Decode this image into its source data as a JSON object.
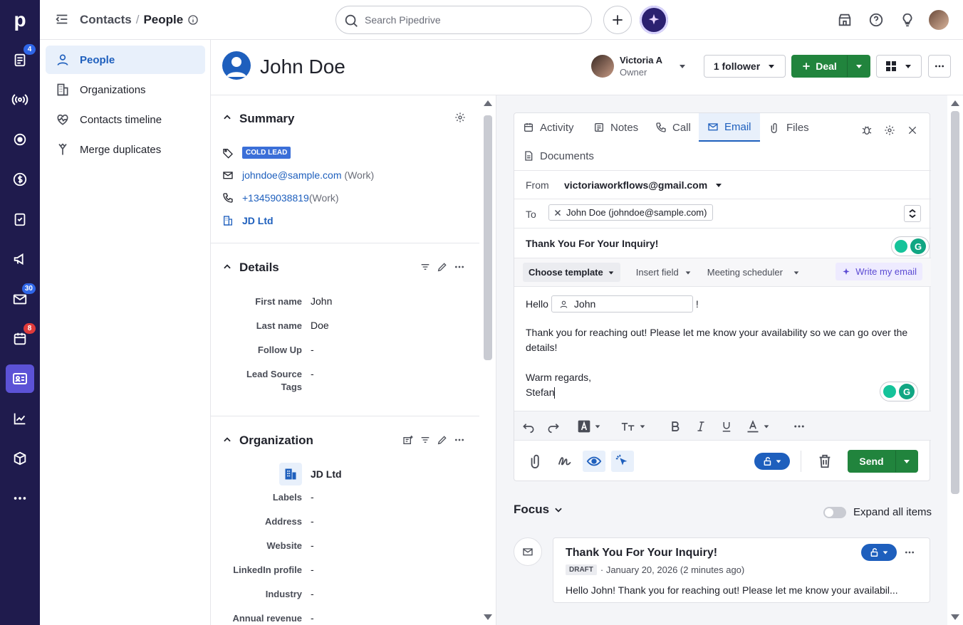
{
  "app": {
    "logo": "p",
    "brand_color": "#1f1b4d",
    "accent": "#1e5fbd"
  },
  "rail": {
    "items": [
      {
        "icon": "leads-icon",
        "badge": "4",
        "badge_color": "#2f66e8"
      },
      {
        "icon": "broadcast-icon"
      },
      {
        "icon": "target-icon"
      },
      {
        "icon": "dollar-icon"
      },
      {
        "icon": "clipboard-icon"
      },
      {
        "icon": "megaphone-icon"
      },
      {
        "icon": "mail-icon",
        "badge": "30",
        "badge_color": "#2f66e8"
      },
      {
        "icon": "calendar-icon",
        "badge": "8",
        "badge_color": "#e03a3a"
      },
      {
        "icon": "contacts-icon",
        "active": true
      },
      {
        "icon": "chart-icon"
      },
      {
        "icon": "box-icon"
      },
      {
        "icon": "more-icon"
      }
    ]
  },
  "topbar": {
    "breadcrumb_parent": "Contacts",
    "breadcrumb_sep": "/",
    "breadcrumb_current": "People",
    "search_placeholder": "Search Pipedrive"
  },
  "sidenav": {
    "items": [
      {
        "label": "People",
        "icon": "person-icon",
        "active": true
      },
      {
        "label": "Organizations",
        "icon": "building-icon"
      },
      {
        "label": "Contacts timeline",
        "icon": "heart-pulse-icon"
      },
      {
        "label": "Merge duplicates",
        "icon": "merge-icon"
      }
    ]
  },
  "header": {
    "person_name": "John Doe",
    "owner_name": "Victoria A",
    "owner_role": "Owner",
    "follower_label": "1 follower",
    "deal_label": "Deal"
  },
  "summary": {
    "title": "Summary",
    "label_tag": "COLD LEAD",
    "email": "johndoe@sample.com",
    "email_type": "(Work)",
    "phone": "+13459038819",
    "phone_type": "(Work)",
    "org": "JD Ltd"
  },
  "details": {
    "title": "Details",
    "fields": [
      {
        "label": "First name",
        "value": "John"
      },
      {
        "label": "Last name",
        "value": "Doe"
      },
      {
        "label": "Follow Up",
        "value": "-"
      },
      {
        "label": "Lead Source Tags",
        "value": "-"
      }
    ]
  },
  "organization": {
    "title": "Organization",
    "name": "JD Ltd",
    "fields": [
      {
        "label": "Labels",
        "value": "-"
      },
      {
        "label": "Address",
        "value": "-"
      },
      {
        "label": "Website",
        "value": "-"
      },
      {
        "label": "LinkedIn profile",
        "value": "-"
      },
      {
        "label": "Industry",
        "value": "-"
      },
      {
        "label": "Annual revenue",
        "value": "-"
      }
    ]
  },
  "composer": {
    "tabs": [
      "Activity",
      "Notes",
      "Call",
      "Email",
      "Files",
      "Documents"
    ],
    "active_tab": "Email",
    "from_label": "From",
    "from_value": "victoriaworkflows@gmail.com",
    "to_label": "To",
    "to_chip": "John Doe (johndoe@sample.com)",
    "subject": "Thank You For Your Inquiry!",
    "choose_template": "Choose template",
    "insert_field": "Insert field",
    "meeting_scheduler": "Meeting scheduler",
    "write_my_email": "Write my email",
    "body_greeting": "Hello",
    "body_field_chip": "John",
    "body_exclaim": "!",
    "body_line1": "Thank you for reaching out! Please let me know your availability so we can go over the details!",
    "body_signoff": "Warm regards,",
    "body_name": "Stefan",
    "send_label": "Send"
  },
  "focus": {
    "title": "Focus",
    "expand_label": "Expand all items",
    "item_title": "Thank You For Your Inquiry!",
    "item_badge": "DRAFT",
    "item_meta": "· January 20, 2026 (2 minutes ago)",
    "item_preview": "Hello John! Thank you for reaching out! Please let me know your availabil..."
  }
}
